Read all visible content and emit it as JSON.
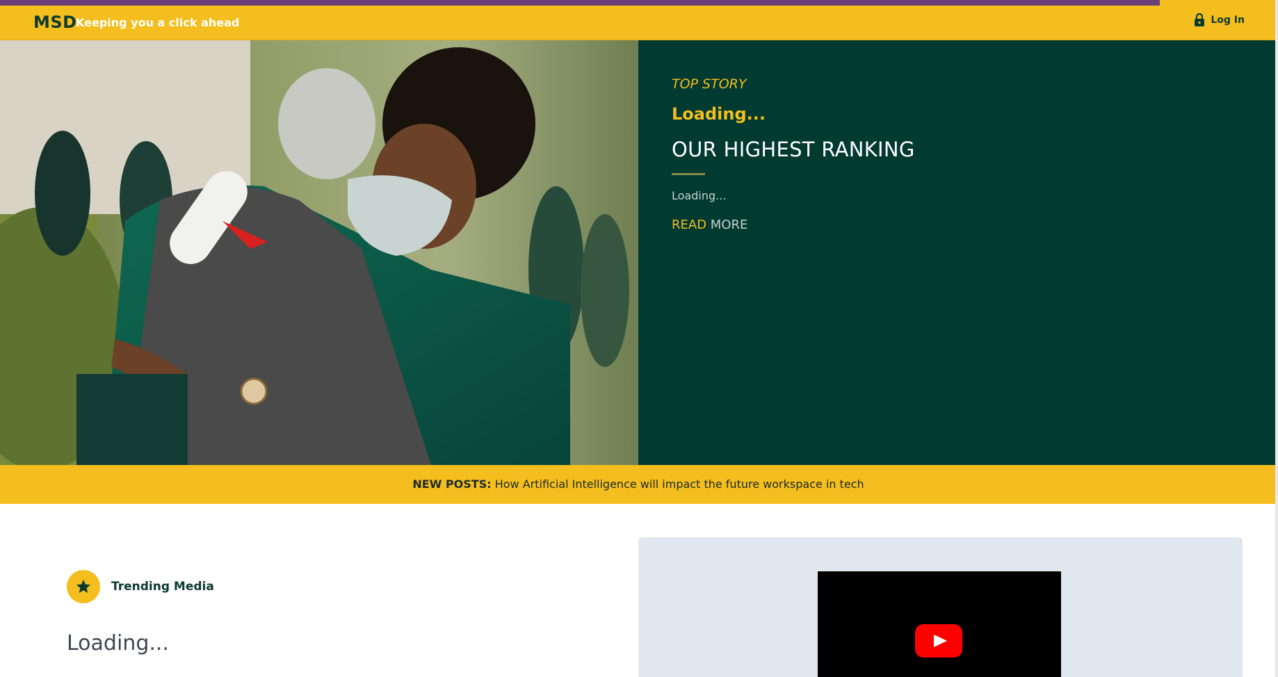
{
  "header": {
    "logo": "MSD",
    "tagline": "Keeping you a click ahead",
    "login_label": "Log In"
  },
  "hero": {
    "kicker": "TOP STORY",
    "loading_title": "Loading...",
    "headline": "OUR HIGHEST RANKING",
    "excerpt": "Loading...",
    "read_label": "READ",
    "more_label": "MORE"
  },
  "ticker": {
    "label": "NEW POSTS:",
    "text": "How Artificial Intelligence will impact the future workspace in tech"
  },
  "trending": {
    "label": "Trending Media",
    "loading": "Loading..."
  },
  "colors": {
    "brand_yellow": "#f3be1e",
    "brand_green": "#013a30",
    "accent_purple": "#6a3f79"
  },
  "icons": {
    "login": "lock-icon",
    "trending": "star-icon",
    "video": "youtube-play-icon"
  }
}
